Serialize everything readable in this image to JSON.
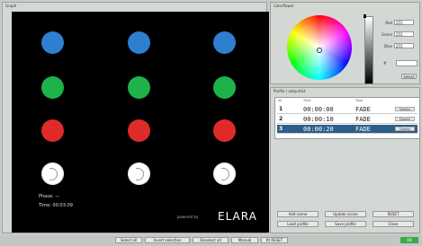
{
  "graph": {
    "title": "Graph",
    "dots": [
      {
        "color": "#2e7fd0"
      },
      {
        "color": "#2e7fd0"
      },
      {
        "color": "#2e7fd0"
      },
      {
        "color": "#1db34a"
      },
      {
        "color": "#1db34a"
      },
      {
        "color": "#1db34a"
      },
      {
        "color": "#e02a2a"
      },
      {
        "color": "#e02a2a"
      },
      {
        "color": "#e02a2a"
      },
      {
        "color": "#ffffff"
      },
      {
        "color": "#ffffff"
      },
      {
        "color": "#ffffff"
      }
    ],
    "phase_label": "Phase: —",
    "time_label": "Time: 00:03:09",
    "powered_by": "powered by",
    "brand": "ELARA"
  },
  "color_panel": {
    "title": "Colorflower",
    "fields": [
      {
        "label": "Red",
        "value": "255"
      },
      {
        "label": "Green",
        "value": "255"
      },
      {
        "label": "Blue",
        "value": "255"
      }
    ],
    "hex_label": "#",
    "hex_value": "",
    "select_label": "Select"
  },
  "profile": {
    "title": "Profile / outputlist",
    "columns": [
      "Nr",
      "Time",
      "Type"
    ],
    "rows": [
      {
        "index": "1",
        "time": "00:00:00",
        "type": "FADE",
        "action": "Delete"
      },
      {
        "index": "2",
        "time": "00:00:10",
        "type": "FADE",
        "action": "Delete"
      },
      {
        "index": "3",
        "time": "00:00:20",
        "type": "FADE",
        "action": "Delete"
      }
    ],
    "buttons": {
      "add_scene": "Add scene",
      "update_scene": "Update scene",
      "reset": "RESET",
      "load_profile": "Load profile",
      "save_profile": "Save profile",
      "close": "Close"
    }
  },
  "bottom_bar": {
    "buttons": [
      "Select all",
      "Invert selection",
      "Deselect all",
      "Manual",
      "Rt RESET"
    ],
    "ok": "OK"
  }
}
